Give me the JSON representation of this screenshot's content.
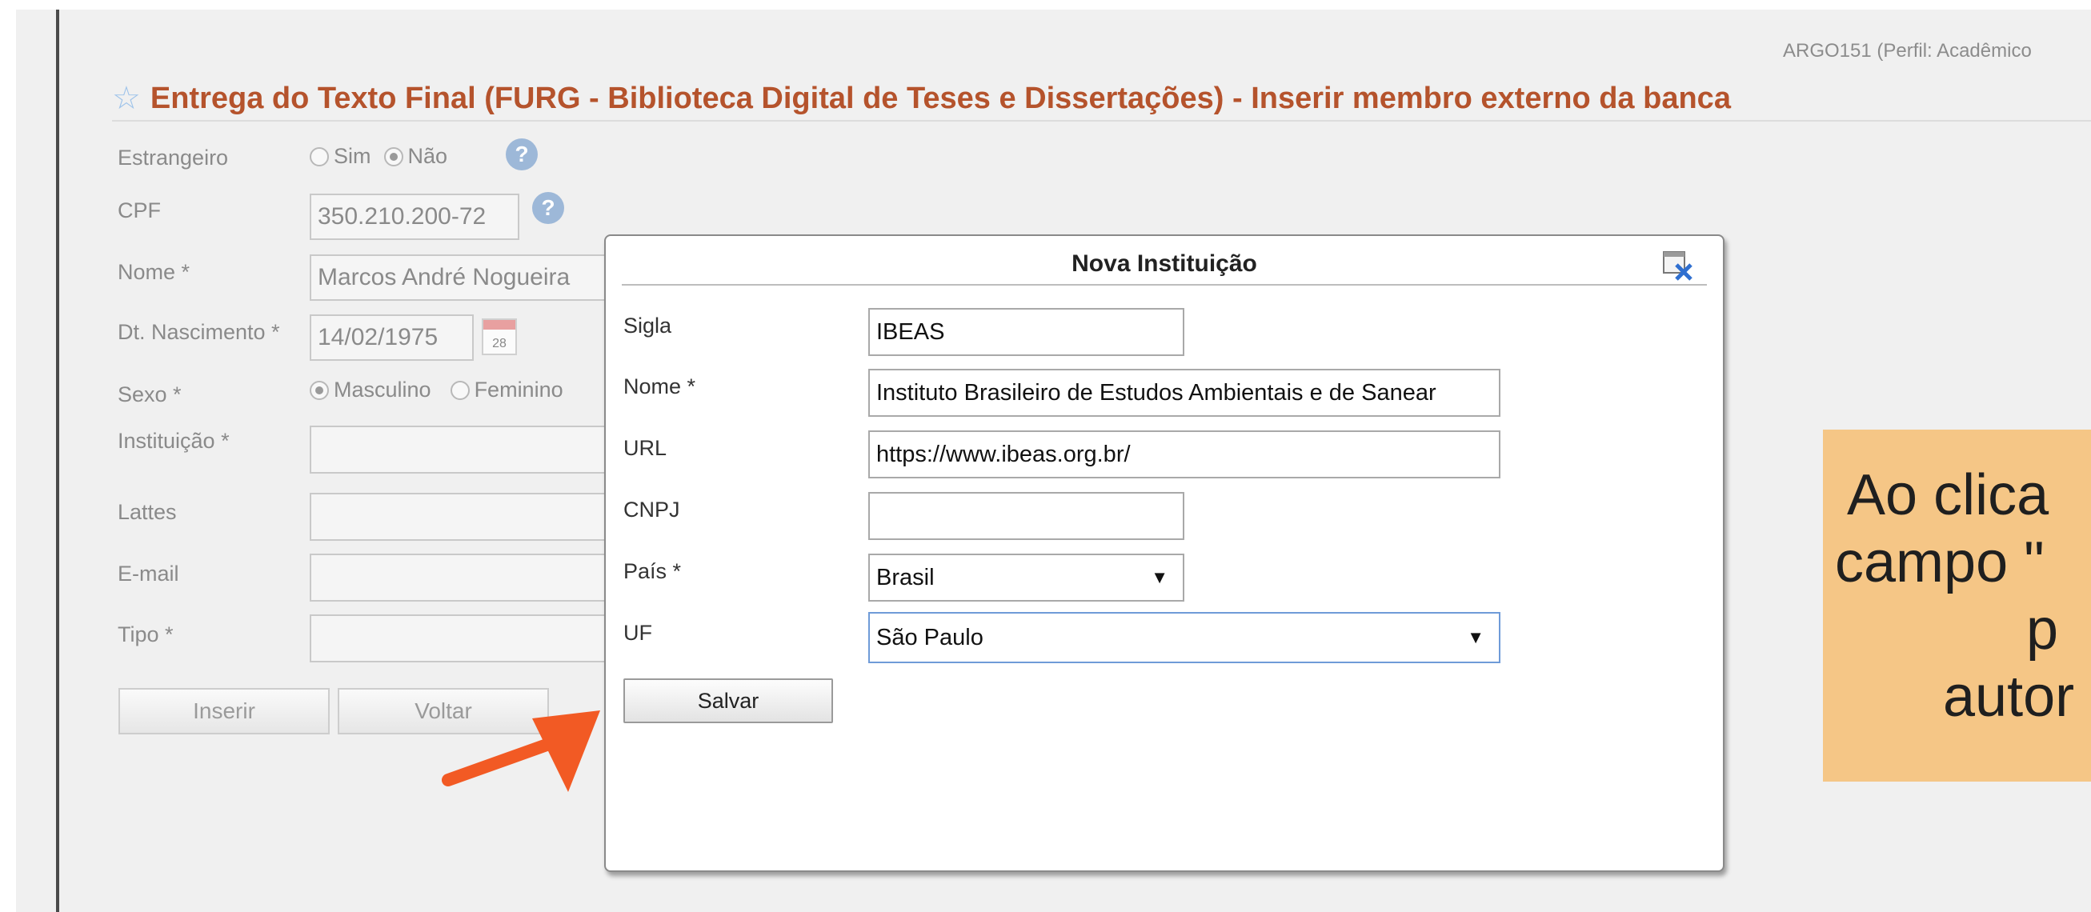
{
  "header": {
    "user_info": "ARGO151  (Perfil: Acadêmico",
    "title": "Entrega do Texto Final (FURG - Biblioteca Digital de Teses e Dissertações) - Inserir membro externo da banca"
  },
  "form": {
    "estrangeiro": {
      "label": "Estrangeiro",
      "options": [
        "Sim",
        "Não"
      ],
      "selected": "Não"
    },
    "cpf": {
      "label": "CPF",
      "value": "350.210.200-72"
    },
    "nome": {
      "label": "Nome *",
      "value": "Marcos André Nogueira"
    },
    "nascimento": {
      "label": "Dt. Nascimento *",
      "value": "14/02/1975",
      "calendar_day": "28"
    },
    "sexo": {
      "label": "Sexo *",
      "options": [
        "Masculino",
        "Feminino"
      ],
      "selected": "Masculino"
    },
    "instituicao": {
      "label": "Instituição *",
      "value": ""
    },
    "lattes": {
      "label": "Lattes",
      "value": ""
    },
    "email": {
      "label": "E-mail",
      "value": ""
    },
    "tipo": {
      "label": "Tipo *",
      "value": ""
    },
    "buttons": {
      "insert": "Inserir",
      "back": "Voltar"
    }
  },
  "modal": {
    "title": "Nova Instituição",
    "fields": {
      "sigla": {
        "label": "Sigla",
        "value": "IBEAS"
      },
      "nome": {
        "label": "Nome *",
        "value": "Instituto Brasileiro de Estudos Ambientais e de Sanear"
      },
      "url": {
        "label": "URL",
        "value": "https://www.ibeas.org.br/"
      },
      "cnpj": {
        "label": "CNPJ",
        "value": ""
      },
      "pais": {
        "label": "País *",
        "value": "Brasil"
      },
      "uf": {
        "label": "UF",
        "value": "São Paulo"
      }
    },
    "save_label": "Salvar"
  },
  "callout": {
    "lines": [
      "Ao clica",
      "campo \"",
      "p",
      "autor"
    ]
  },
  "colors": {
    "title": "#b5532c",
    "arrow": "#f25a24",
    "callout_bg": "#f5c686",
    "help_icon": "#9db8d8"
  },
  "icons": {
    "favorite": "star-outline",
    "help": "question-circle",
    "calendar": "calendar",
    "close": "window-close",
    "pointer": "arrow"
  }
}
